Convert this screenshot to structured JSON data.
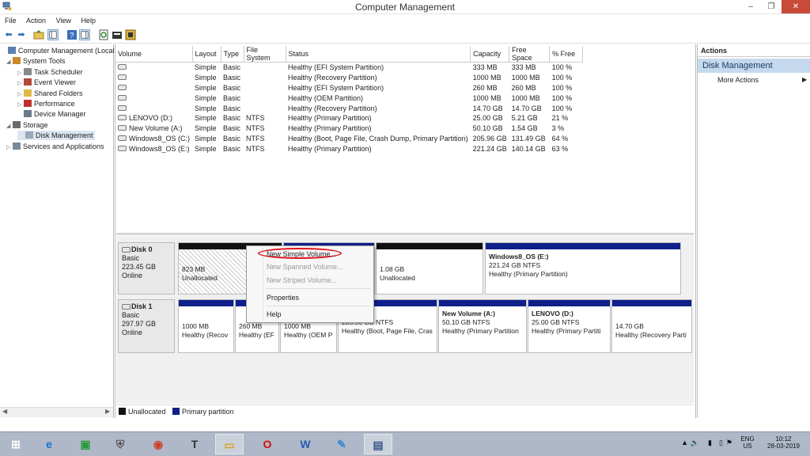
{
  "window": {
    "title": "Computer Management",
    "controls": [
      "–",
      "❐",
      "✕"
    ]
  },
  "menu": [
    "File",
    "Action",
    "View",
    "Help"
  ],
  "tree": {
    "items": [
      {
        "label": "Computer Management (Local",
        "icon": "computer-icon",
        "level": 0,
        "expander": ""
      },
      {
        "label": "System Tools",
        "icon": "tools-icon",
        "level": 1,
        "expander": "◢"
      },
      {
        "label": "Task Scheduler",
        "icon": "clock-icon",
        "level": 2,
        "expander": "▷"
      },
      {
        "label": "Event Viewer",
        "icon": "event-viewer-icon",
        "level": 2,
        "expander": "▷"
      },
      {
        "label": "Shared Folders",
        "icon": "folder-icon",
        "level": 2,
        "expander": "▷"
      },
      {
        "label": "Performance",
        "icon": "performance-icon",
        "level": 2,
        "expander": "▷"
      },
      {
        "label": "Device Manager",
        "icon": "device-manager-icon",
        "level": 2,
        "expander": ""
      },
      {
        "label": "Storage",
        "icon": "storage-icon",
        "level": 1,
        "expander": "◢"
      },
      {
        "label": "Disk Management",
        "icon": "disk-icon",
        "level": 2,
        "expander": "",
        "selected": true
      },
      {
        "label": "Services and Applications",
        "icon": "services-icon",
        "level": 1,
        "expander": "▷"
      }
    ]
  },
  "volumes": {
    "columns": [
      "Volume",
      "Layout",
      "Type",
      "File System",
      "Status",
      "Capacity",
      "Free Space",
      "% Free"
    ],
    "rows": [
      [
        "",
        "Simple",
        "Basic",
        "",
        "Healthy (EFI System Partition)",
        "333 MB",
        "333 MB",
        "100 %"
      ],
      [
        "",
        "Simple",
        "Basic",
        "",
        "Healthy (Recovery Partition)",
        "1000 MB",
        "1000 MB",
        "100 %"
      ],
      [
        "",
        "Simple",
        "Basic",
        "",
        "Healthy (EFI System Partition)",
        "260 MB",
        "260 MB",
        "100 %"
      ],
      [
        "",
        "Simple",
        "Basic",
        "",
        "Healthy (OEM Partition)",
        "1000 MB",
        "1000 MB",
        "100 %"
      ],
      [
        "",
        "Simple",
        "Basic",
        "",
        "Healthy (Recovery Partition)",
        "14.70 GB",
        "14.70 GB",
        "100 %"
      ],
      [
        "LENOVO (D:)",
        "Simple",
        "Basic",
        "NTFS",
        "Healthy (Primary Partition)",
        "25.00 GB",
        "5.21 GB",
        "21 %"
      ],
      [
        "New Volume (A:)",
        "Simple",
        "Basic",
        "NTFS",
        "Healthy (Primary Partition)",
        "50.10 GB",
        "1.54 GB",
        "3 %"
      ],
      [
        "Windows8_OS (C:)",
        "Simple",
        "Basic",
        "NTFS",
        "Healthy (Boot, Page File, Crash Dump, Primary Partition)",
        "205.96 GB",
        "131.49 GB",
        "64 %"
      ],
      [
        "Windows8_OS (E:)",
        "Simple",
        "Basic",
        "NTFS",
        "Healthy (Primary Partition)",
        "221.24 GB",
        "140.14 GB",
        "63 %"
      ]
    ]
  },
  "disks": [
    {
      "name": "Disk 0",
      "type": "Basic",
      "size": "223.45 GB",
      "state": "Online",
      "partitions": [
        {
          "l1": "",
          "l2": "823 MB",
          "l3": "Unallocated",
          "bar": "black",
          "hatched": true
        },
        {
          "l1": "",
          "l2": "",
          "l3": "",
          "bar": "blue"
        },
        {
          "l1": "",
          "l2": "1.08 GB",
          "l3": "Unallocated",
          "bar": "black"
        },
        {
          "l1": "Windows8_OS  (E:)",
          "l2": "221.24 GB NTFS",
          "l3": "Healthy (Primary Partition)",
          "bar": "blue"
        }
      ]
    },
    {
      "name": "Disk 1",
      "type": "Basic",
      "size": "297.97 GB",
      "state": "Online",
      "partitions": [
        {
          "l1": "",
          "l2": "1000 MB",
          "l3": "Healthy (Recov",
          "bar": "blue"
        },
        {
          "l1": "",
          "l2": "260 MB",
          "l3": "Healthy (EF",
          "bar": "blue"
        },
        {
          "l1": "",
          "l2": "1000 MB",
          "l3": "Healthy (OEM P",
          "bar": "blue"
        },
        {
          "l1": "8_OS  (C:)",
          "l2": "205.96 GB NTFS",
          "l3": "Healthy (Boot, Page File, Cras",
          "bar": "blue"
        },
        {
          "l1": "New Volume  (A:)",
          "l2": "50.10 GB NTFS",
          "l3": "Healthy (Primary Partition",
          "bar": "blue"
        },
        {
          "l1": "LENOVO  (D:)",
          "l2": "25.00 GB NTFS",
          "l3": "Healthy (Primary Partiti",
          "bar": "blue"
        },
        {
          "l1": "",
          "l2": "14.70 GB",
          "l3": "Healthy (Recovery Parti",
          "bar": "blue"
        }
      ]
    }
  ],
  "legend": {
    "unallocated": "Unallocated",
    "primary": "Primary partition"
  },
  "actions": {
    "header": "Actions",
    "section": "Disk Management",
    "more": "More Actions"
  },
  "context_menu": {
    "items": [
      "New Simple Volume...",
      "New Spanned Volume...",
      "New Striped Volume...",
      "Properties",
      "Help"
    ],
    "disabled": [
      false,
      true,
      true,
      false,
      false
    ]
  },
  "taskbar": {
    "apps": [
      "windows-start-icon",
      "internet-explorer-icon",
      "store-icon",
      "security-icon",
      "chrome-icon",
      "tex-icon",
      "file-explorer-icon",
      "opera-icon",
      "word-icon",
      "paint-icon",
      "computer-management-icon"
    ],
    "tray": {
      "lang": "ENG",
      "region": "US",
      "time": "10:12",
      "date": "28-03-2019"
    }
  },
  "colors": {
    "primary_partition": "#0f1f8a",
    "unallocated": "#111111",
    "context_highlight": "#e0151d",
    "selected_action": "#c5d9ee"
  }
}
